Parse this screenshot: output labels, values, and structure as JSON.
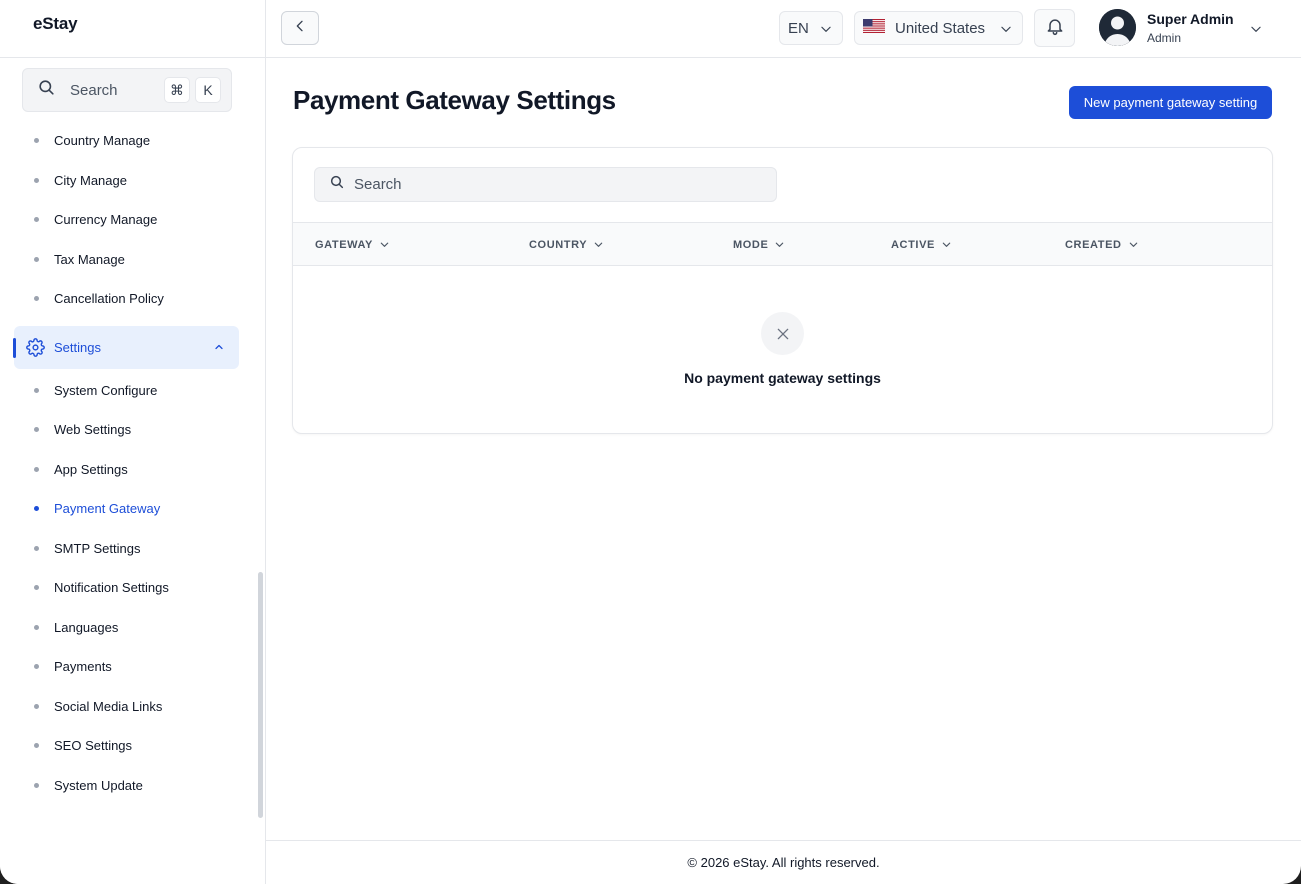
{
  "app": {
    "brand": "eStay"
  },
  "sidebar": {
    "search": {
      "label": "Search",
      "kbd_cmd": "⌘",
      "kbd_key": "K"
    },
    "items_top": [
      {
        "label": "Country Manage"
      },
      {
        "label": "City Manage"
      },
      {
        "label": "Currency Manage"
      },
      {
        "label": "Tax Manage"
      },
      {
        "label": "Cancellation Policy"
      }
    ],
    "group": {
      "label": "Settings",
      "icon": "gear-icon",
      "expanded": true
    },
    "items_settings": [
      {
        "label": "System Configure"
      },
      {
        "label": "Web Settings"
      },
      {
        "label": "App Settings"
      },
      {
        "label": "Payment Gateway",
        "active": true
      },
      {
        "label": "SMTP Settings"
      },
      {
        "label": "Notification Settings"
      },
      {
        "label": "Languages"
      },
      {
        "label": "Payments"
      },
      {
        "label": "Social Media Links"
      },
      {
        "label": "SEO Settings"
      },
      {
        "label": "System Update"
      }
    ]
  },
  "topbar": {
    "language": "EN",
    "country": "United States",
    "user": {
      "name": "Super Admin",
      "role": "Admin"
    }
  },
  "main": {
    "title": "Payment Gateway Settings",
    "new_button": "New payment gateway setting",
    "table": {
      "search_placeholder": "Search",
      "columns": [
        "GATEWAY",
        "COUNTRY",
        "MODE",
        "ACTIVE",
        "CREATED"
      ],
      "rows": [],
      "empty_text": "No payment gateway settings"
    }
  },
  "footer": {
    "text": "© 2026 eStay. All rights reserved."
  },
  "colors": {
    "accent": "#1d4ed8",
    "active_bg": "#e8f0fd"
  }
}
